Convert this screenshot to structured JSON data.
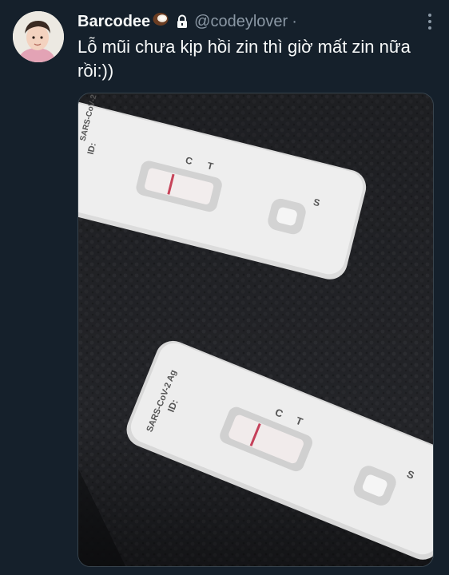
{
  "tweet": {
    "display_name": "Barcodee",
    "handle": "@codeylover",
    "separator": "·",
    "text": "Lỗ mũi chưa kịp hồi zin thì giờ mất zin nữa rồi:))"
  },
  "icons": {
    "name_emoji": "coconut-emoji-icon",
    "protected": "lock-icon",
    "more": "more-options-icon"
  },
  "media": {
    "test_1": {
      "brand": "SARS-CoV-2 Ag",
      "id_label": "ID:",
      "c_label": "C",
      "t_label": "T",
      "s_label": "S"
    },
    "test_2": {
      "brand": "SARS-CoV-2 Ag",
      "id_label": "ID:",
      "c_label": "C",
      "t_label": "T",
      "s_label": "S"
    }
  },
  "colors": {
    "background": "#15202b",
    "text_primary": "#f7f9f9",
    "text_secondary": "#8b98a5"
  }
}
